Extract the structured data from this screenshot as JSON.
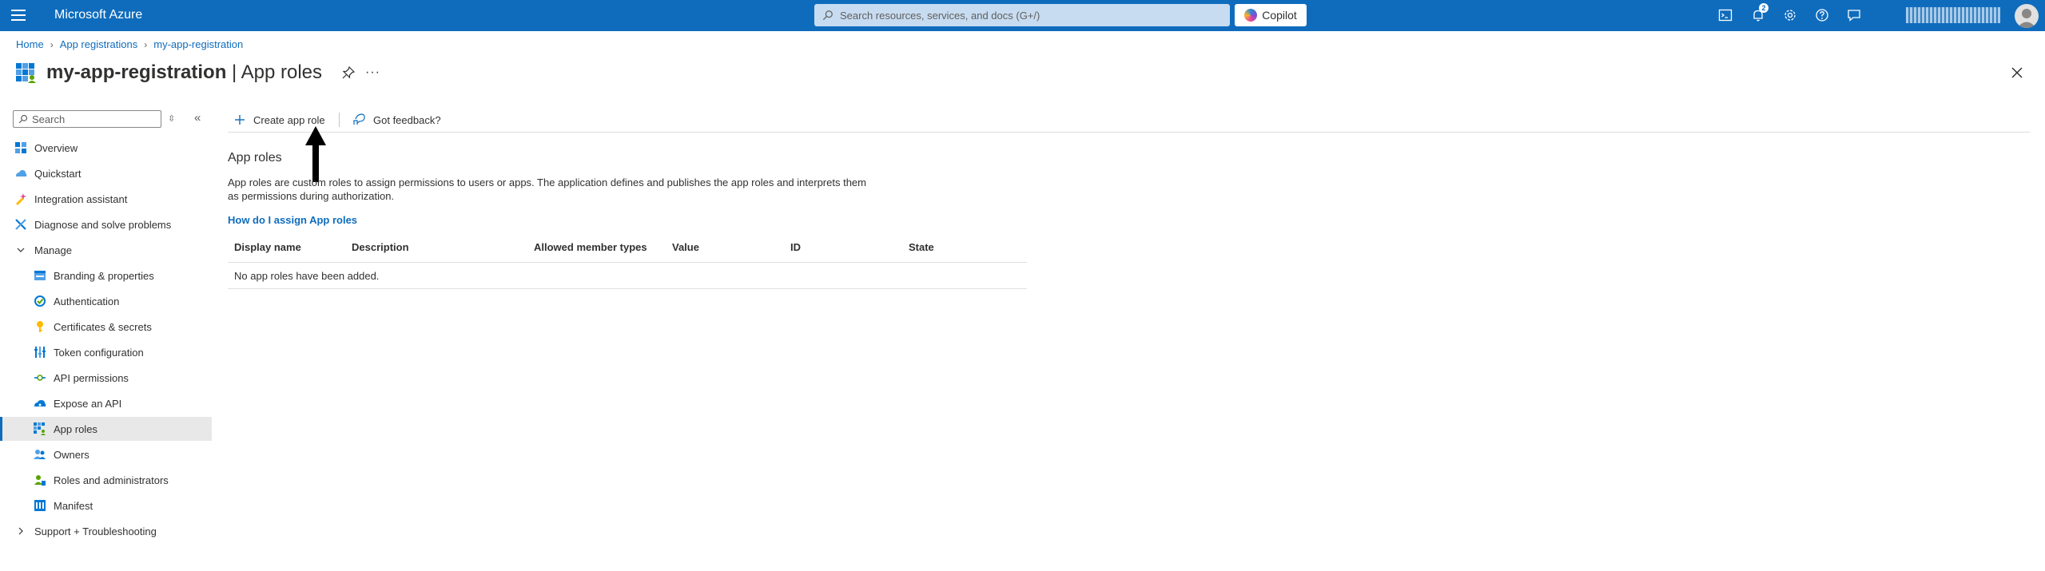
{
  "topbar": {
    "brand": "Microsoft Azure",
    "search_placeholder": "Search resources, services, and docs (G+/)",
    "copilot_label": "Copilot",
    "notifications_count": "2",
    "icons": [
      "cloud-shell-icon",
      "notifications-icon",
      "settings-icon",
      "help-icon",
      "feedback-icon"
    ],
    "accent_color": "#0f6cbd"
  },
  "breadcrumb": [
    "Home",
    "App registrations",
    "my-app-registration"
  ],
  "title": {
    "app_name": "my-app-registration",
    "separator": " | ",
    "blade_name": "App roles",
    "more": "···"
  },
  "sidebar": {
    "search_placeholder": "Search",
    "items": [
      {
        "label": "Overview",
        "icon": "overview-icon"
      },
      {
        "label": "Quickstart",
        "icon": "quickstart-icon"
      },
      {
        "label": "Integration assistant",
        "icon": "integration-assistant-icon"
      },
      {
        "label": "Diagnose and solve problems",
        "icon": "diagnose-icon"
      },
      {
        "label": "Manage",
        "icon": "chevron-down-icon"
      },
      {
        "label": "Branding & properties",
        "icon": "branding-icon"
      },
      {
        "label": "Authentication",
        "icon": "authentication-icon"
      },
      {
        "label": "Certificates & secrets",
        "icon": "key-icon"
      },
      {
        "label": "Token configuration",
        "icon": "token-icon"
      },
      {
        "label": "API permissions",
        "icon": "api-permissions-icon"
      },
      {
        "label": "Expose an API",
        "icon": "expose-api-icon"
      },
      {
        "label": "App roles",
        "icon": "app-roles-icon",
        "selected": true
      },
      {
        "label": "Owners",
        "icon": "owners-icon"
      },
      {
        "label": "Roles and administrators",
        "icon": "roles-icon"
      },
      {
        "label": "Manifest",
        "icon": "manifest-icon"
      },
      {
        "label": "Support + Troubleshooting",
        "icon": "chevron-right-icon"
      }
    ]
  },
  "commands": {
    "create": "Create app role",
    "feedback": "Got feedback?"
  },
  "content": {
    "section_title": "App roles",
    "description": "App roles are custom roles to assign permissions to users or apps. The application defines and publishes the app roles and interprets them as permissions during authorization.",
    "help_link": "How do I assign App roles",
    "table": {
      "columns": [
        "Display name",
        "Description",
        "Allowed member types",
        "Value",
        "ID",
        "State"
      ],
      "empty_message": "No app roles have been added."
    }
  }
}
